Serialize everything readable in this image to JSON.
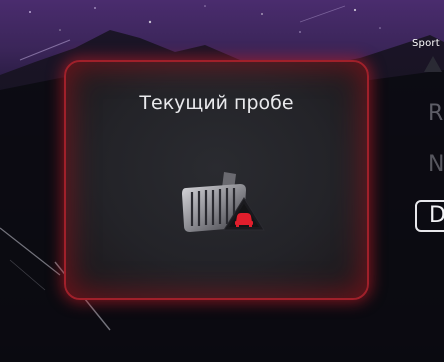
{
  "header": {
    "drive_mode_label": "Sport"
  },
  "gear_selector": {
    "items": [
      "R",
      "N",
      "D"
    ],
    "selected": "D"
  },
  "warning_dialog": {
    "title": "Текущий пробе",
    "icon": "brake-pedal-warning-icon"
  },
  "colors": {
    "alert_red": "#c41e2a",
    "panel_bg": "#232328",
    "accent_white": "#ffffff"
  }
}
